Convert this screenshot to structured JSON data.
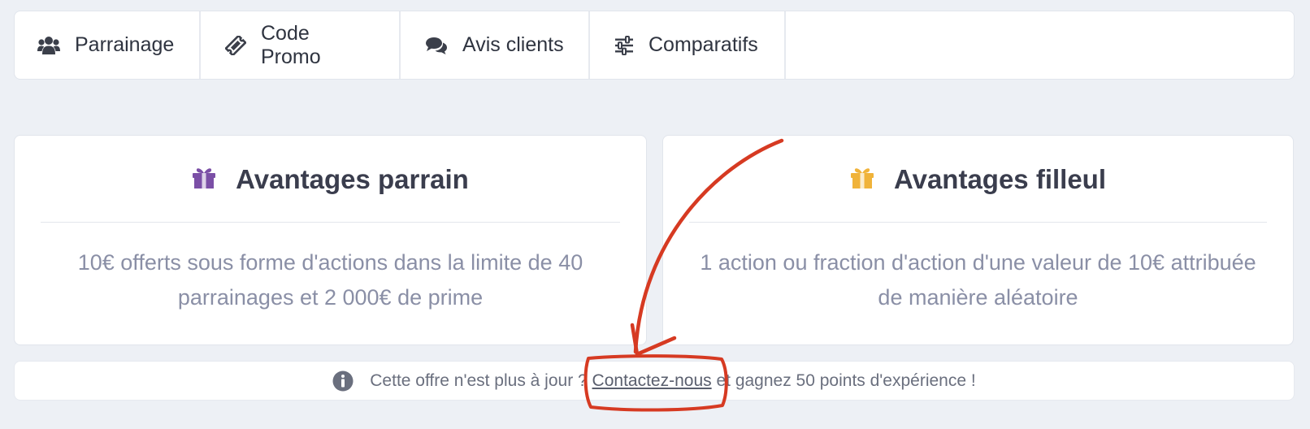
{
  "nav": {
    "tabs": [
      {
        "label": "Parrainage",
        "icon": "users-icon"
      },
      {
        "label": "Code Promo",
        "icon": "ticket-icon"
      },
      {
        "label": "Avis clients",
        "icon": "comments-icon"
      },
      {
        "label": "Comparatifs",
        "icon": "sliders-icon"
      }
    ]
  },
  "cards": {
    "parrain": {
      "title": "Avantages parrain",
      "icon": "gift-icon",
      "icon_color": "#7b4fa6",
      "description": "10€ offerts sous forme d'actions dans la limite de 40 parrainages et 2 000€ de prime"
    },
    "filleul": {
      "title": "Avantages filleul",
      "icon": "gift-icon",
      "icon_color": "#f0b33a",
      "description": "1 action ou fraction d'action d'une valeur de 10€ attribuée de manière aléatoire"
    }
  },
  "notice": {
    "icon": "info-circle-icon",
    "text_before": "Cette offre n'est plus à jour ? ",
    "link": "Contactez-nous",
    "text_after": " et gagnez 50 points d'expérience !"
  },
  "annotation": {
    "color": "#d63a22"
  }
}
